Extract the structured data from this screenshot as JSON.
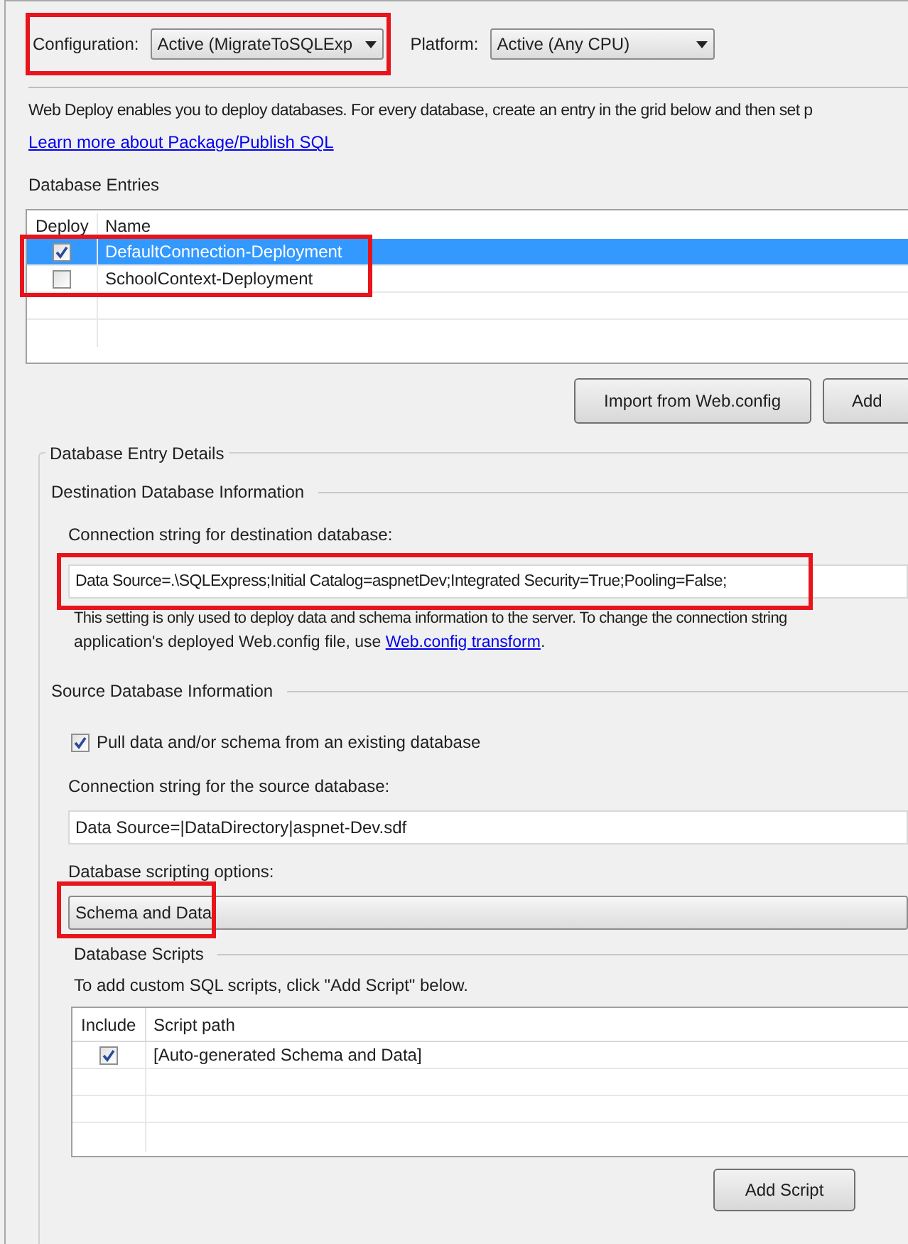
{
  "configuration": {
    "label": "Configuration:",
    "value": "Active (MigrateToSQLExp",
    "highlighted": true
  },
  "platform": {
    "label": "Platform:",
    "value": "Active (Any CPU)"
  },
  "intro": {
    "text": "Web Deploy enables you to deploy databases. For every database, create an entry in the grid below and then set p",
    "link": "Learn more about Package/Publish SQL"
  },
  "database_entries": {
    "title": "Database Entries",
    "columns": [
      "Deploy",
      "Name"
    ],
    "highlighted": true,
    "rows": [
      {
        "deploy": true,
        "name": "DefaultConnection-Deployment",
        "selected": true
      },
      {
        "deploy": false,
        "name": "SchoolContext-Deployment",
        "selected": false
      }
    ]
  },
  "entry_buttons": [
    "Import from Web.config",
    "Add"
  ],
  "details": {
    "title": "Database Entry Details",
    "destination": {
      "title": "Destination Database Information",
      "label": "Connection string for destination database:",
      "value": "Data Source=.\\SQLExpress;Initial Catalog=aspnetDev;Integrated Security=True;Pooling=False;",
      "highlighted": true,
      "note_line": "This setting is only used to deploy data and schema information to the server. To change the connection string",
      "note_text": "application's deployed Web.config file, use ",
      "note_link": "Web.config transform",
      "note_end": "."
    },
    "source": {
      "title": "Source Database Information",
      "pull": {
        "label": "Pull data and/or schema from an existing database",
        "checked": true
      },
      "label": "Connection string for the source database:",
      "value": "Data Source=|DataDirectory|aspnet-Dev.sdf",
      "scripting_label": "Database scripting options:",
      "scripting_value": "Schema and Data",
      "scripting_highlighted": true
    },
    "scripts": {
      "title": "Database Scripts",
      "hint": "To add custom SQL scripts, click \"Add Script\" below.",
      "columns": [
        "Include",
        "Script path"
      ],
      "rows": [
        {
          "include": true,
          "path": "[Auto-generated Schema and Data]"
        }
      ],
      "button": "Add Script"
    }
  }
}
